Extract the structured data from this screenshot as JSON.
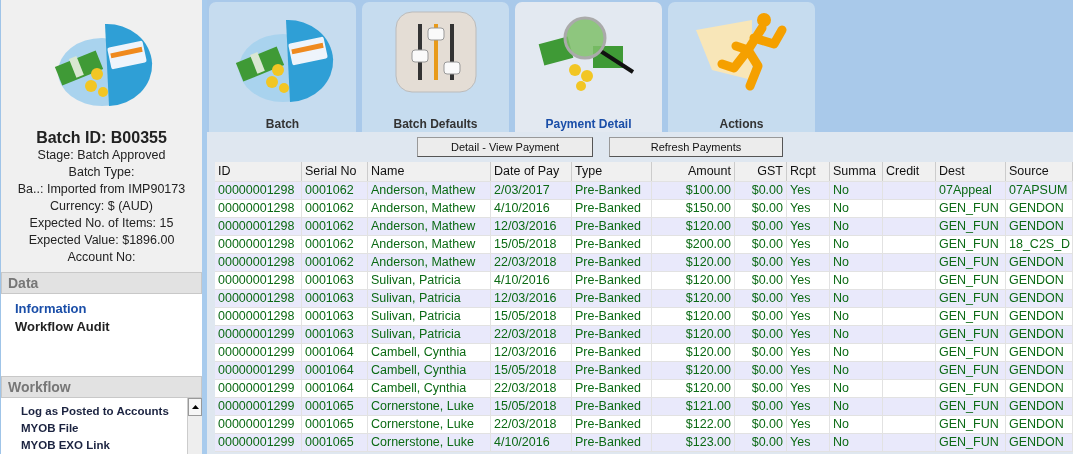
{
  "batch_panel": {
    "title": "Batch ID: B00355",
    "lines": [
      "Stage: Batch Approved",
      "Batch Type:",
      "Ba..: Imported from IMP90173",
      "Currency: $ (AUD)",
      "Expected No. of Items: 15",
      "Expected Value: $1896.00",
      "Account No:"
    ]
  },
  "data_section": {
    "header": "Data",
    "items": [
      {
        "label": "Information",
        "selected": true
      },
      {
        "label": "Workflow Audit",
        "selected": false
      }
    ]
  },
  "workflow_section": {
    "header": "Workflow",
    "items": [
      "Log as Posted to Accounts",
      "MYOB File",
      "MYOB EXO Link"
    ]
  },
  "tabs": [
    {
      "label": "Batch",
      "kind": "money",
      "selected": false
    },
    {
      "label": "Batch Defaults",
      "kind": "sliders",
      "selected": false
    },
    {
      "label": "Payment Detail",
      "kind": "search",
      "selected": true
    },
    {
      "label": "Actions",
      "kind": "runner",
      "selected": false
    }
  ],
  "buttons": [
    "Detail - View Payment",
    "Refresh Payments"
  ],
  "table": {
    "columns": [
      "ID",
      "Serial No",
      "Name",
      "Date of Pay",
      "Type",
      "Amount",
      "GST",
      "Rcpt",
      "Summa",
      "Credit",
      "Dest",
      "Source"
    ],
    "rows": [
      {
        "id": "00000001298",
        "serial_no": "0001062",
        "name": "Anderson, Mathew",
        "date": "2/03/2017",
        "type": "Pre-Banked",
        "amount": "$100.00",
        "gst": "$0.00",
        "rcpt": "Yes",
        "summary": "No",
        "dest": "07Appeal",
        "source": "07APSUM"
      },
      {
        "id": "00000001298",
        "serial_no": "0001062",
        "name": "Anderson, Mathew",
        "date": "4/10/2016",
        "type": "Pre-Banked",
        "amount": "$150.00",
        "gst": "$0.00",
        "rcpt": "Yes",
        "summary": "No",
        "dest": "GEN_FUN",
        "source": "GENDON"
      },
      {
        "id": "00000001298",
        "serial_no": "0001062",
        "name": "Anderson, Mathew",
        "date": "12/03/2016",
        "type": "Pre-Banked",
        "amount": "$120.00",
        "gst": "$0.00",
        "rcpt": "Yes",
        "summary": "No",
        "dest": "GEN_FUN",
        "source": "GENDON"
      },
      {
        "id": "00000001298",
        "serial_no": "0001062",
        "name": "Anderson, Mathew",
        "date": "15/05/2018",
        "type": "Pre-Banked",
        "amount": "$200.00",
        "gst": "$0.00",
        "rcpt": "Yes",
        "summary": "No",
        "dest": "GEN_FUN",
        "source": "18_C2S_D"
      },
      {
        "id": "00000001298",
        "serial_no": "0001062",
        "name": "Anderson, Mathew",
        "date": "22/03/2018",
        "type": "Pre-Banked",
        "amount": "$120.00",
        "gst": "$0.00",
        "rcpt": "Yes",
        "summary": "No",
        "dest": "GEN_FUN",
        "source": "GENDON"
      },
      {
        "id": "00000001298",
        "serial_no": "0001063",
        "name": "Sulivan, Patricia",
        "date": "4/10/2016",
        "type": "Pre-Banked",
        "amount": "$120.00",
        "gst": "$0.00",
        "rcpt": "Yes",
        "summary": "No",
        "dest": "GEN_FUN",
        "source": "GENDON"
      },
      {
        "id": "00000001298",
        "serial_no": "0001063",
        "name": "Sulivan, Patricia",
        "date": "12/03/2016",
        "type": "Pre-Banked",
        "amount": "$120.00",
        "gst": "$0.00",
        "rcpt": "Yes",
        "summary": "No",
        "dest": "GEN_FUN",
        "source": "GENDON"
      },
      {
        "id": "00000001298",
        "serial_no": "0001063",
        "name": "Sulivan, Patricia",
        "date": "15/05/2018",
        "type": "Pre-Banked",
        "amount": "$120.00",
        "gst": "$0.00",
        "rcpt": "Yes",
        "summary": "No",
        "dest": "GEN_FUN",
        "source": "GENDON"
      },
      {
        "id": "00000001299",
        "serial_no": "0001063",
        "name": "Sulivan, Patricia",
        "date": "22/03/2018",
        "type": "Pre-Banked",
        "amount": "$120.00",
        "gst": "$0.00",
        "rcpt": "Yes",
        "summary": "No",
        "dest": "GEN_FUN",
        "source": "GENDON"
      },
      {
        "id": "00000001299",
        "serial_no": "0001064",
        "name": "Cambell, Cynthia",
        "date": "12/03/2016",
        "type": "Pre-Banked",
        "amount": "$120.00",
        "gst": "$0.00",
        "rcpt": "Yes",
        "summary": "No",
        "dest": "GEN_FUN",
        "source": "GENDON"
      },
      {
        "id": "00000001299",
        "serial_no": "0001064",
        "name": "Cambell, Cynthia",
        "date": "15/05/2018",
        "type": "Pre-Banked",
        "amount": "$120.00",
        "gst": "$0.00",
        "rcpt": "Yes",
        "summary": "No",
        "dest": "GEN_FUN",
        "source": "GENDON"
      },
      {
        "id": "00000001299",
        "serial_no": "0001064",
        "name": "Cambell, Cynthia",
        "date": "22/03/2018",
        "type": "Pre-Banked",
        "amount": "$120.00",
        "gst": "$0.00",
        "rcpt": "Yes",
        "summary": "No",
        "dest": "GEN_FUN",
        "source": "GENDON"
      },
      {
        "id": "00000001299",
        "serial_no": "0001065",
        "name": "Cornerstone, Luke",
        "date": "15/05/2018",
        "type": "Pre-Banked",
        "amount": "$121.00",
        "gst": "$0.00",
        "rcpt": "Yes",
        "summary": "No",
        "dest": "GEN_FUN",
        "source": "GENDON"
      },
      {
        "id": "00000001299",
        "serial_no": "0001065",
        "name": "Cornerstone, Luke",
        "date": "22/03/2018",
        "type": "Pre-Banked",
        "amount": "$122.00",
        "gst": "$0.00",
        "rcpt": "Yes",
        "summary": "No",
        "dest": "GEN_FUN",
        "source": "GENDON"
      },
      {
        "id": "00000001299",
        "serial_no": "0001065",
        "name": "Cornerstone, Luke",
        "date": "4/10/2016",
        "type": "Pre-Banked",
        "amount": "$123.00",
        "gst": "$0.00",
        "rcpt": "Yes",
        "summary": "No",
        "dest": "GEN_FUN",
        "source": "GENDON"
      }
    ]
  }
}
